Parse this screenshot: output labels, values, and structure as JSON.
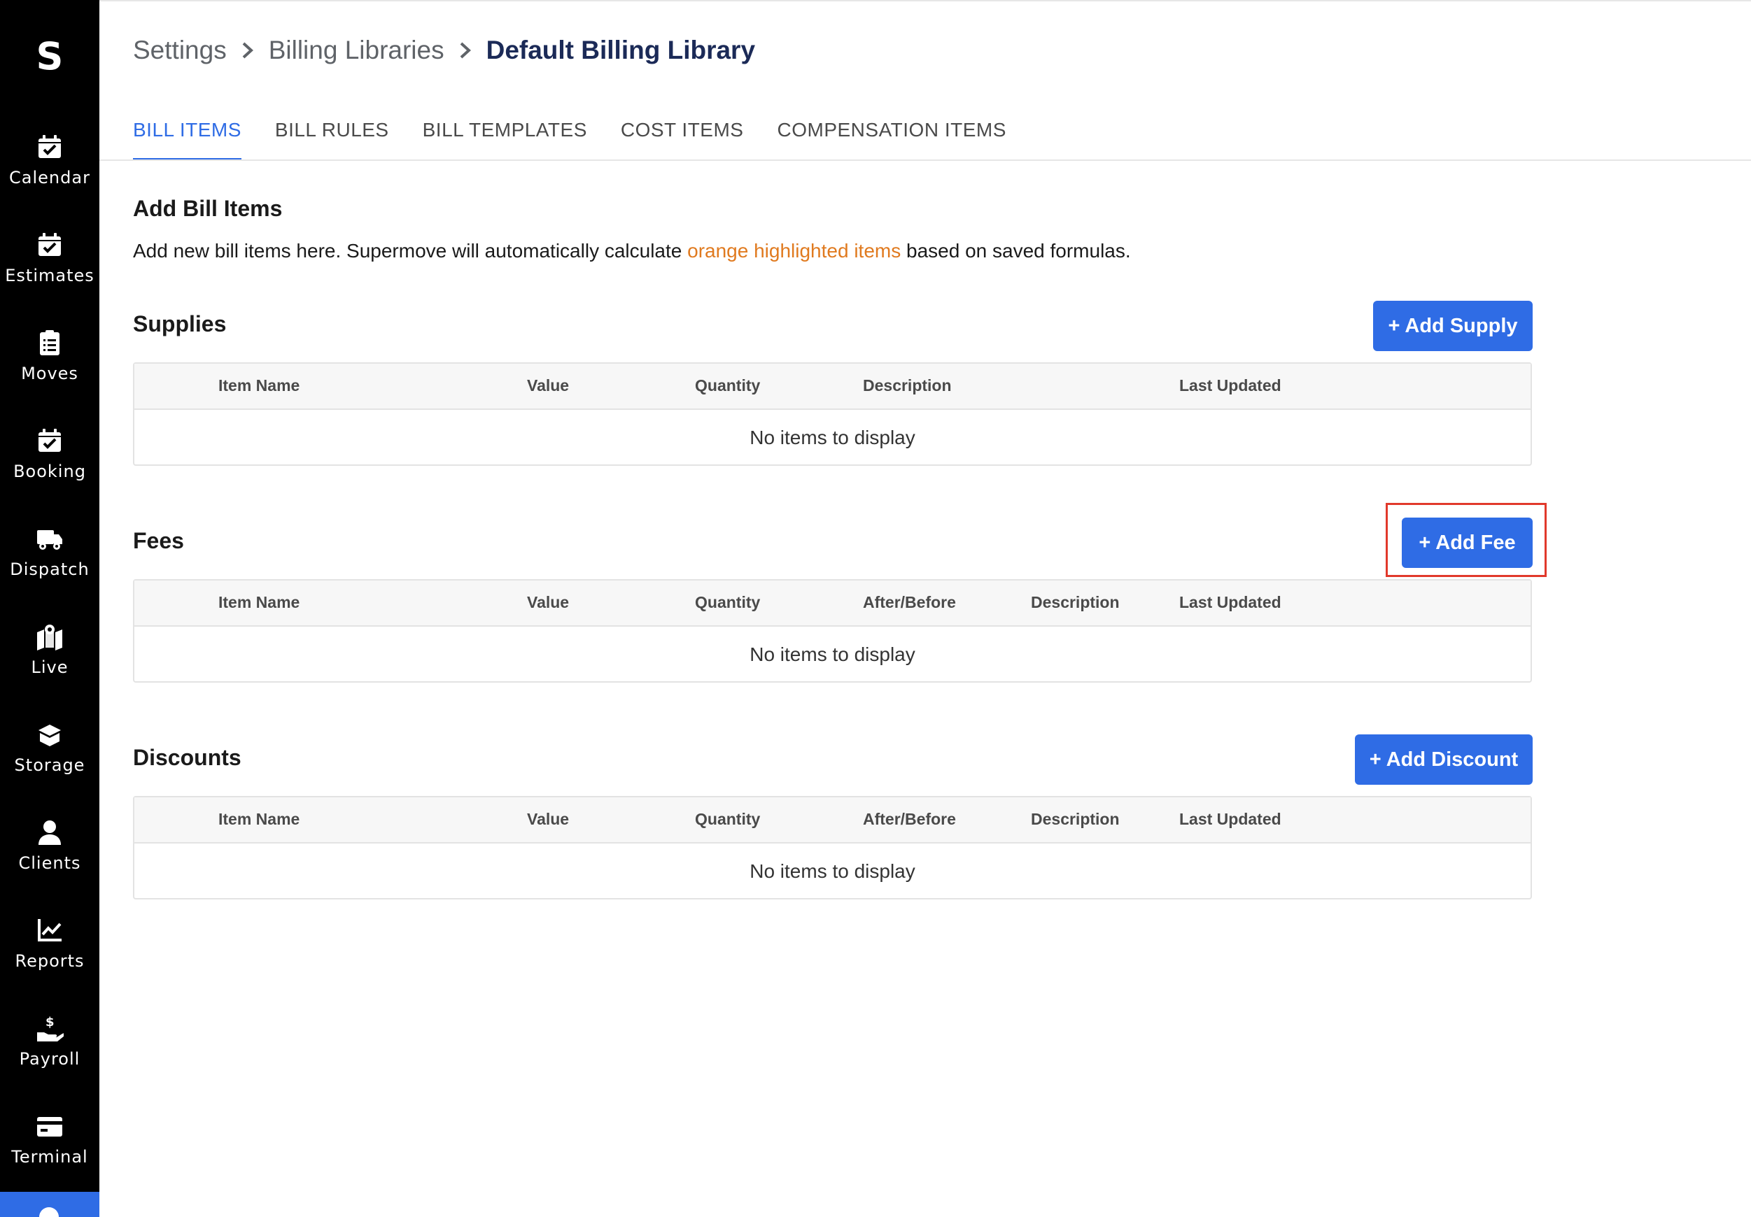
{
  "sidebar": {
    "logo": "S",
    "items": [
      {
        "label": "Calendar",
        "icon": "calendar-check-icon"
      },
      {
        "label": "Estimates",
        "icon": "calendar-check-icon"
      },
      {
        "label": "Moves",
        "icon": "clipboard-list-icon"
      },
      {
        "label": "Booking",
        "icon": "calendar-check-icon"
      },
      {
        "label": "Dispatch",
        "icon": "truck-icon"
      },
      {
        "label": "Live",
        "icon": "map-marker-icon"
      },
      {
        "label": "Storage",
        "icon": "box-open-icon"
      },
      {
        "label": "Clients",
        "icon": "user-icon"
      },
      {
        "label": "Reports",
        "icon": "chart-line-icon"
      },
      {
        "label": "Payroll",
        "icon": "hand-dollar-icon"
      },
      {
        "label": "Terminal",
        "icon": "credit-card-icon"
      }
    ]
  },
  "breadcrumb": {
    "items": [
      "Settings",
      "Billing Libraries",
      "Default Billing Library"
    ]
  },
  "tabs": [
    "BILL ITEMS",
    "BILL RULES",
    "BILL TEMPLATES",
    "COST ITEMS",
    "COMPENSATION ITEMS"
  ],
  "active_tab": "BILL ITEMS",
  "intro": {
    "title": "Add Bill Items",
    "desc_before": "Add new bill items here. Supermove will automatically calculate ",
    "desc_highlight": "orange highlighted items",
    "desc_after": " based on saved formulas.",
    "highlight_color": "#e07a1f"
  },
  "supplies": {
    "title": "Supplies",
    "button": "+ Add Supply",
    "columns": [
      "Item Name",
      "Value",
      "Quantity",
      "Description",
      "Last Updated"
    ],
    "empty": "No items to display"
  },
  "fees": {
    "title": "Fees",
    "button": "+ Add Fee",
    "columns": [
      "Item Name",
      "Value",
      "Quantity",
      "After/Before",
      "Description",
      "Last Updated"
    ],
    "empty": "No items to display"
  },
  "discounts": {
    "title": "Discounts",
    "button": "+ Add Discount",
    "columns": [
      "Item Name",
      "Value",
      "Quantity",
      "After/Before",
      "Description",
      "Last Updated"
    ],
    "empty": "No items to display"
  },
  "colors": {
    "accent": "#2f6ce5",
    "sidebar": "#000000",
    "highlight_border": "#e1392b"
  }
}
